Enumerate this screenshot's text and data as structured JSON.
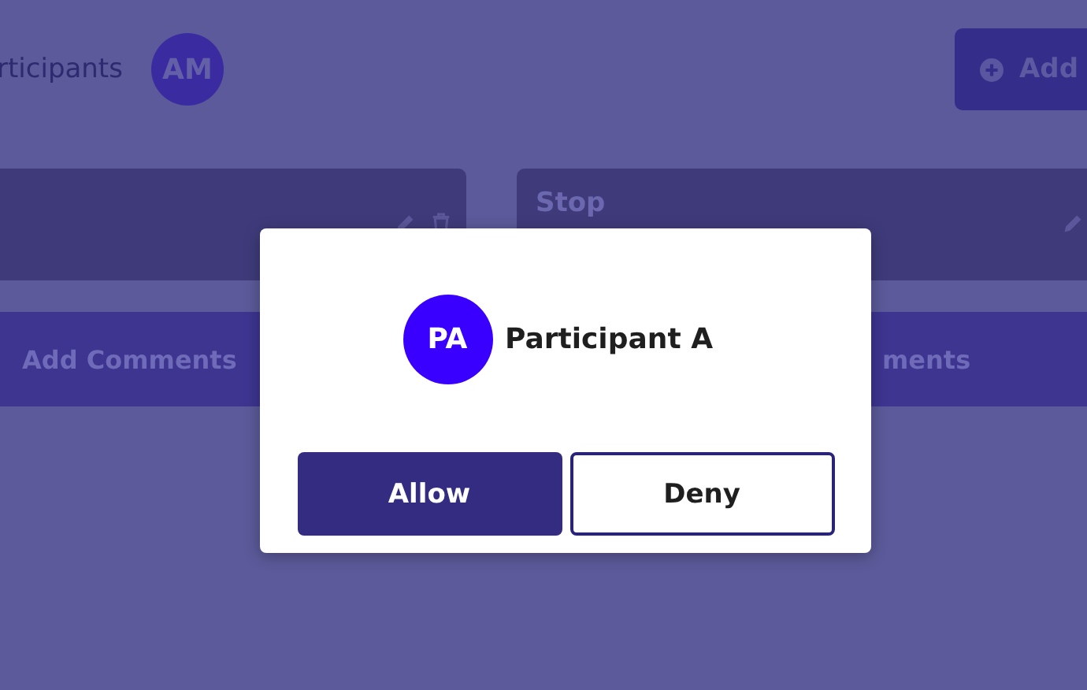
{
  "header": {
    "participants_label": "rticipants",
    "avatar_initials": "AM",
    "add_button": "Add"
  },
  "cards": [
    {
      "actions": [
        {
          "kind": "edit"
        },
        {
          "kind": "delete"
        }
      ]
    },
    {
      "title": "Stop",
      "actions": [
        {
          "kind": "edit"
        }
      ]
    }
  ],
  "comment_bars": [
    "Add Comments",
    "ments"
  ],
  "dialog": {
    "avatar_initials": "PA",
    "name": "Participant A",
    "buttons": [
      {
        "label": "Allow",
        "kind": "primary"
      },
      {
        "label": "Deny",
        "kind": "secondary"
      }
    ]
  }
}
